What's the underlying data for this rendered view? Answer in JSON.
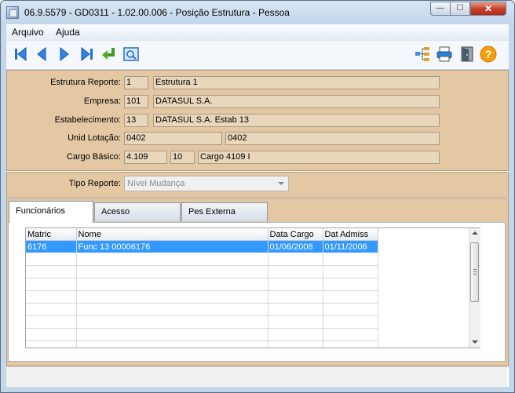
{
  "window": {
    "title": "06.9.5579 - GD0311 - 1.02.00.006 - Posição Estrutura - Pessoa",
    "controls": {
      "minimize": "—",
      "maximize": "☐",
      "close": "✕"
    }
  },
  "menu": {
    "items": [
      {
        "label": "Arquivo"
      },
      {
        "label": "Ajuda"
      }
    ]
  },
  "toolbar": {
    "left": [
      "first-record-icon",
      "previous-record-icon",
      "next-record-icon",
      "last-record-icon",
      "goto-enter-icon",
      "zoom-search-icon"
    ],
    "right": [
      "hierarchy-tree-icon",
      "print-icon",
      "exit-door-icon",
      "help-question-icon"
    ]
  },
  "form": {
    "estrutura_reporte": {
      "label": "Estrutura Reporte:",
      "code": "1",
      "desc": "Estrutura 1"
    },
    "empresa": {
      "label": "Empresa:",
      "code": "101",
      "desc": "DATASUL S.A."
    },
    "estabelecimento": {
      "label": "Estabelecimento:",
      "code": "13",
      "desc": "DATASUL S.A. Estab 13"
    },
    "unid_lotacao": {
      "label": "Unid Lotação:",
      "code": "0402",
      "desc": "0402"
    },
    "cargo_basico": {
      "label": "Cargo Básico:",
      "code": "4.109",
      "nivel": "10",
      "desc": "Cargo 4109 I"
    },
    "tipo_reporte": {
      "label": "Tipo Reporte:",
      "value": "Nível Mudança"
    }
  },
  "tabs": [
    {
      "label": "Funcionários"
    },
    {
      "label": "Acesso"
    },
    {
      "label": "Pes Externa"
    }
  ],
  "grid": {
    "columns": [
      "Matric",
      "Nome",
      "Data Cargo",
      "Dat Admiss"
    ],
    "rows": [
      {
        "matric": "6176",
        "nome": "Func 13 00006176",
        "data_cargo": "01/06/2008",
        "dat_admiss": "01/11/2006"
      }
    ]
  },
  "colors": {
    "panel": "#e3c8a3",
    "selection": "#3399ff",
    "toolbar_icon": "#1f6fd1"
  }
}
